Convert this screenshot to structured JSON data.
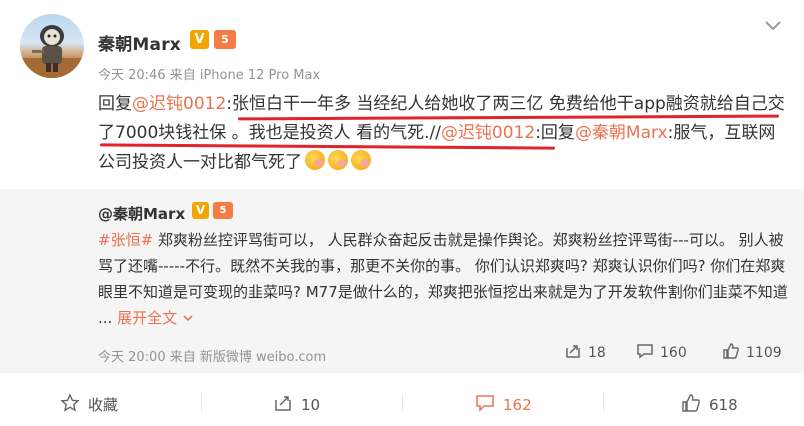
{
  "post": {
    "username": "秦朝Marx",
    "verified_badge": "V",
    "level_badge": "5",
    "meta": "今天 20:46 来自 iPhone 12 Pro Max",
    "text_prefix": "回复",
    "mention1": "@迟钝0012",
    "text_main": ":张恒白干一年多 当经纪人给她收了两三亿 免费给他干app融资就给自己交了7000块钱社保 。我也是投资人 看的气死.//",
    "mention2": "@迟钝0012",
    "text_mid": ":回复",
    "mention3": "@秦朝Marx",
    "text_end": ":服气，互联网公司投资人一对比都气死了"
  },
  "quote": {
    "username": "@秦朝Marx",
    "verified_badge": "V",
    "level_badge": "5",
    "topic": "#张恒#",
    "text": " 郑爽粉丝控评骂街可以， 人民群众奋起反击就是操作舆论。郑爽粉丝控评骂街---可以。 别人被骂了还嘴-----不行。既然不关我的事，那更不关你的事。 你们认识郑爽吗? 郑爽认识你们吗? 你们在郑爽眼里不知道是可变现的韭菜吗? M77是做什么的，郑爽把张恒挖出来就是为了开发软件割你们韭菜不知道 ...",
    "expand": "展开全文",
    "meta": "今天 20:00 来自 新版微博 weibo.com",
    "repost_count": "18",
    "comment_count": "160",
    "like_count": "1109"
  },
  "footer": {
    "favorite_label": "收藏",
    "repost_count": "10",
    "comment_count": "162",
    "like_count": "618"
  },
  "colors": {
    "link": "#eb7350",
    "underline": "#e2232a",
    "quote_bg": "#f5f5f5"
  }
}
